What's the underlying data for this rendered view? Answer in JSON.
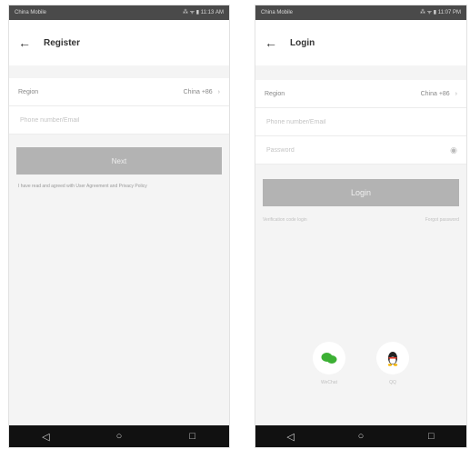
{
  "register_screen": {
    "status_left": "China Mobile",
    "status_right": "⁂ ᯤ ▮ 11:13 AM",
    "title": "Register",
    "region_label": "Region",
    "region_value": "China +86",
    "phone_placeholder": "Phone number/Email",
    "next_label": "Next",
    "agreement_text": "I have read and agreed with User Agreement and Privacy Policy"
  },
  "login_screen": {
    "status_left": "China Mobile",
    "status_right": "⁂ ᯤ ▮ 11:07 PM",
    "title": "Login",
    "region_label": "Region",
    "region_value": "China +86",
    "phone_placeholder": "Phone number/Email",
    "password_placeholder": "Password",
    "login_label": "Login",
    "quick_login": "Verification code login",
    "forgot_password": "Forgot password",
    "social": [
      {
        "label": "WeChat",
        "icon": "wechat-icon",
        "color": "#3cb034"
      },
      {
        "label": "QQ",
        "icon": "qq-icon",
        "color": "#222222"
      }
    ]
  },
  "colors": {
    "button": "#b3b3b3",
    "background": "#f4f4f4",
    "status_bar": "#4a4a4a",
    "nav_bar": "#111111"
  },
  "icons": [
    "back-arrow-icon",
    "chevron-right-icon",
    "eye-icon",
    "nav-back-icon",
    "nav-home-icon",
    "nav-recent-icon"
  ]
}
